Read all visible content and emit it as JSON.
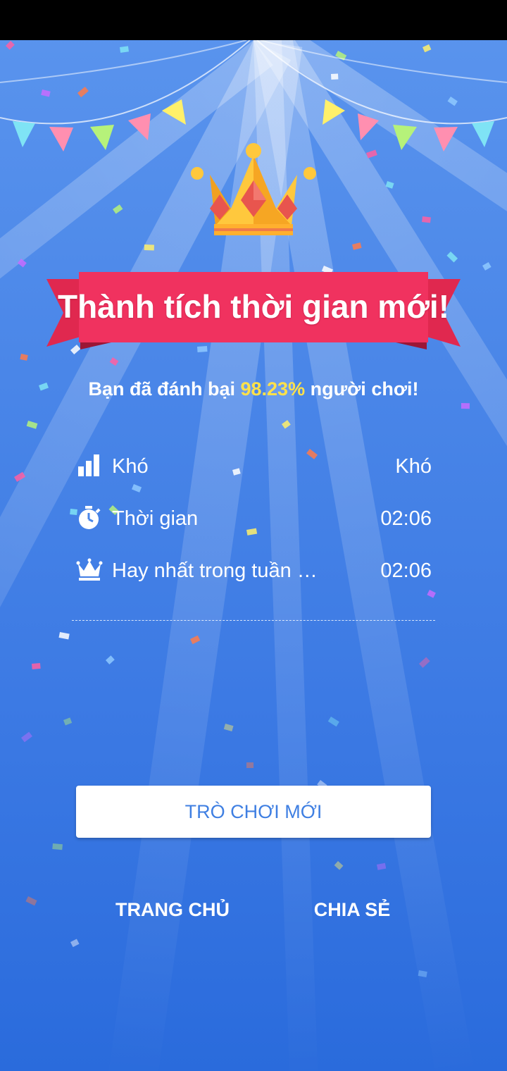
{
  "title": "Thành tích thời gian mới!",
  "subtitle": {
    "prefix": "Bạn đã đánh bại ",
    "percent": "98.23%",
    "suffix": " người chơi!"
  },
  "stats": [
    {
      "icon": "bar-chart-icon",
      "label": "Khó",
      "value": "Khó"
    },
    {
      "icon": "stopwatch-icon",
      "label": "Thời gian",
      "value": "02:06"
    },
    {
      "icon": "crown-icon",
      "label": "Hay nhất trong tuần …",
      "value": "02:06"
    }
  ],
  "buttons": {
    "new_game": "TRÒ CHƠI MỚI",
    "home": "TRANG CHỦ",
    "share": "CHIA SẺ"
  },
  "colors": {
    "background": "#4a86e8",
    "ribbon": "#f0325f",
    "ribbon_dark": "#c81f4a",
    "highlight": "#ffe14a",
    "button_text": "#3f7fe2"
  }
}
